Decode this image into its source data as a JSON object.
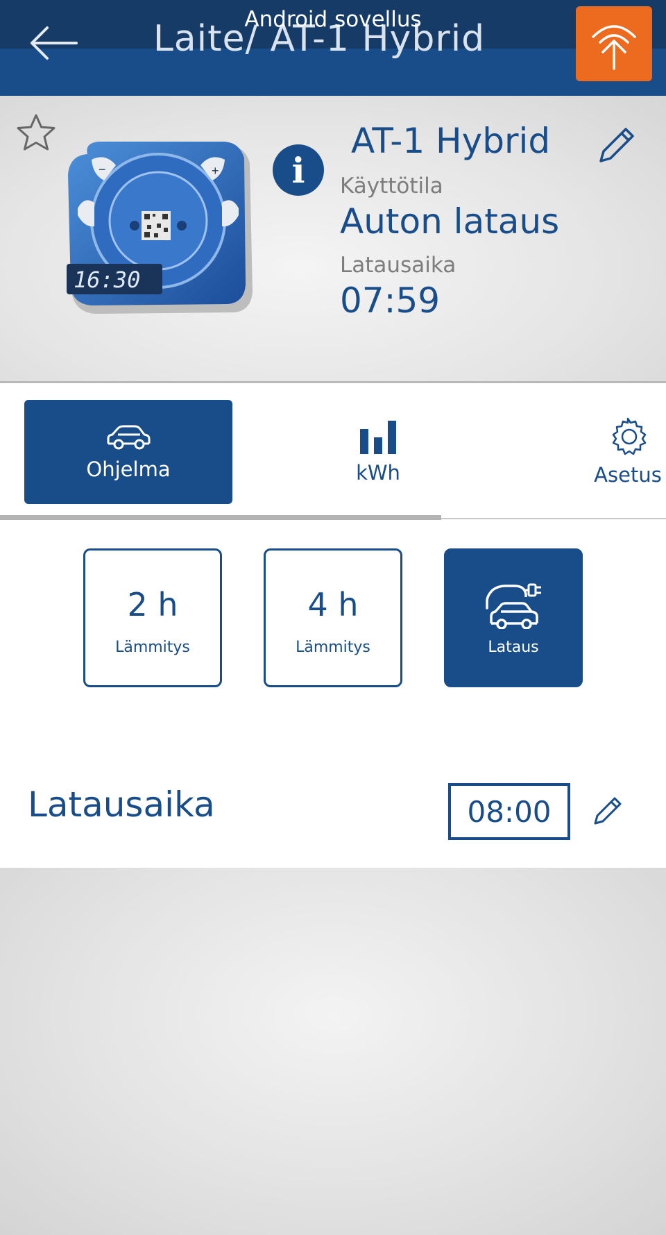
{
  "overlay": {
    "label": "Android sovellus"
  },
  "appbar": {
    "title": "Laite/ AT-1 Hybrid",
    "back_icon": "arrow-left-icon",
    "sync_icon": "signal-upload-icon",
    "sync_color": "#ec6b1e",
    "bar_color": "#184d8a"
  },
  "device": {
    "name": "AT-1 Hybrid",
    "mode_label": "Käyttötila",
    "mode_value": "Auton lataus",
    "time_label": "Latausaika",
    "time_value": "07:59",
    "display_time": "16:30",
    "info_glyph": "i",
    "favorite_icon": "star-outline-icon",
    "edit_icon": "pencil-icon"
  },
  "tabs": [
    {
      "label": "Ohjelma",
      "icon": "car-icon",
      "active": true
    },
    {
      "label": "kWh",
      "icon": "bar-chart-icon",
      "active": false
    },
    {
      "label": "Asetus",
      "icon": "gear-icon",
      "active": false
    }
  ],
  "programs": [
    {
      "value": "2 h",
      "label": "Lämmitys",
      "active": false
    },
    {
      "value": "4 h",
      "label": "Lämmitys",
      "active": false
    },
    {
      "icon": "car-charging-icon",
      "label": "Lataus",
      "active": true
    }
  ],
  "charge_time": {
    "label": "Latausaika",
    "value": "08:00",
    "edit_icon": "pencil-icon"
  }
}
